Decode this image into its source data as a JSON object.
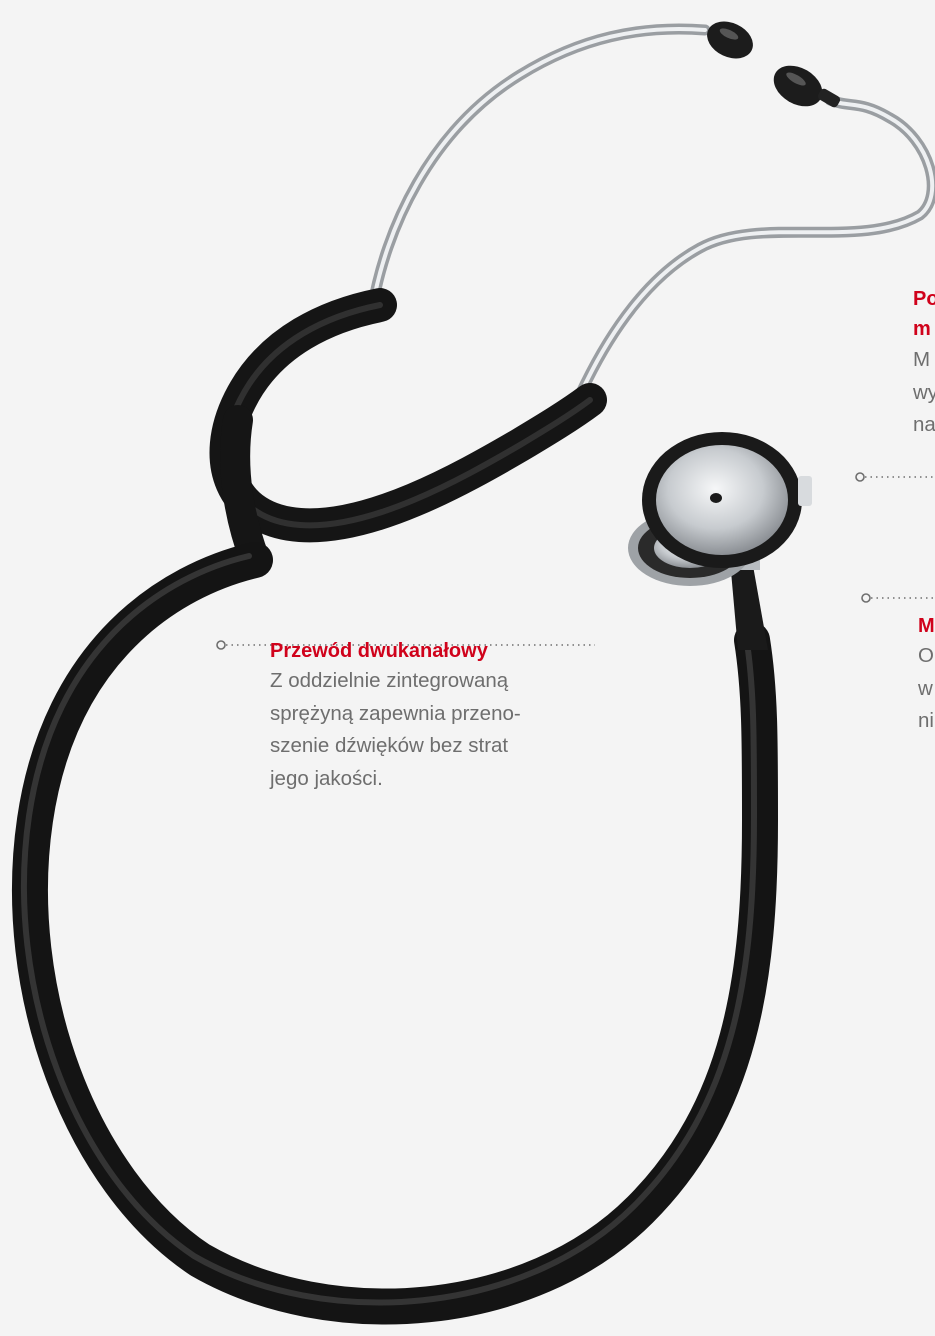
{
  "callouts": {
    "cable": {
      "title": "Przewód dwukanałowy",
      "lines": [
        "Z oddzielnie zintegrowaną",
        "sprężyną zapewnia przeno-",
        "szenie dźwięków bez strat",
        "jego jakości."
      ]
    },
    "top_right": {
      "title_lines": [
        "Po",
        "m"
      ],
      "lines": [
        "M",
        "wy",
        "na"
      ]
    },
    "bottom_right": {
      "title": "M",
      "lines": [
        "O",
        "w",
        "ni"
      ]
    }
  },
  "colors": {
    "accent": "#d0021b",
    "text": "#6e6e6e",
    "background": "#f4f4f4",
    "tubing": "#151515",
    "metal": "#c9ccd0"
  }
}
